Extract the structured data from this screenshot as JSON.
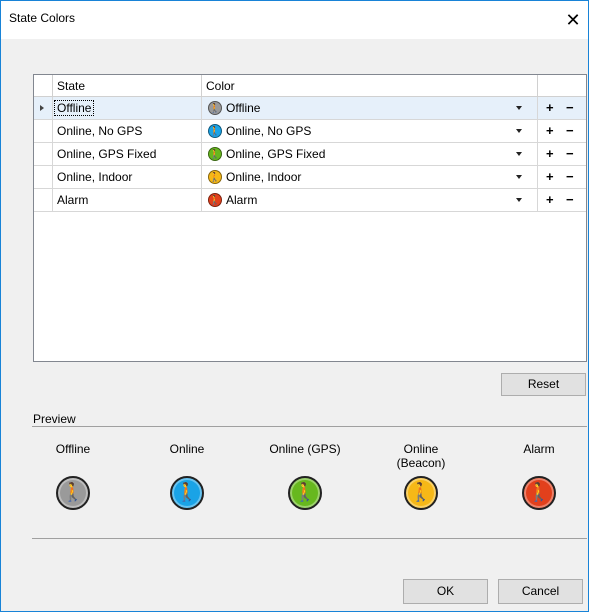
{
  "window": {
    "title": "State Colors",
    "close_glyph": "✕"
  },
  "grid": {
    "headers": {
      "state": "State",
      "color": "Color"
    },
    "rows": [
      {
        "state": "Offline",
        "color": "Offline",
        "hex": "#9a9a9a",
        "selected": true
      },
      {
        "state": "Online, No GPS",
        "color": "Online, No GPS",
        "hex": "#1aa3e6"
      },
      {
        "state": "Online, GPS Fixed",
        "color": "Online, GPS Fixed",
        "hex": "#67b81e"
      },
      {
        "state": "Online, Indoor",
        "color": "Online, Indoor",
        "hex": "#f6b817"
      },
      {
        "state": "Alarm",
        "color": "Alarm",
        "hex": "#e2401c"
      }
    ],
    "add_glyph": "+",
    "remove_glyph": "−"
  },
  "buttons": {
    "reset": "Reset",
    "ok": "OK",
    "cancel": "Cancel"
  },
  "preview": {
    "label": "Preview",
    "icon_glyph": "🚶",
    "items": [
      {
        "label": "Offline",
        "hex": "#9a9a9a"
      },
      {
        "label": "Online",
        "hex": "#1aa3e6"
      },
      {
        "label": "Online (GPS)",
        "hex": "#67b81e"
      },
      {
        "label": "Online (Beacon)",
        "hex": "#f6b817"
      },
      {
        "label": "Alarm",
        "hex": "#e2401c"
      }
    ]
  }
}
